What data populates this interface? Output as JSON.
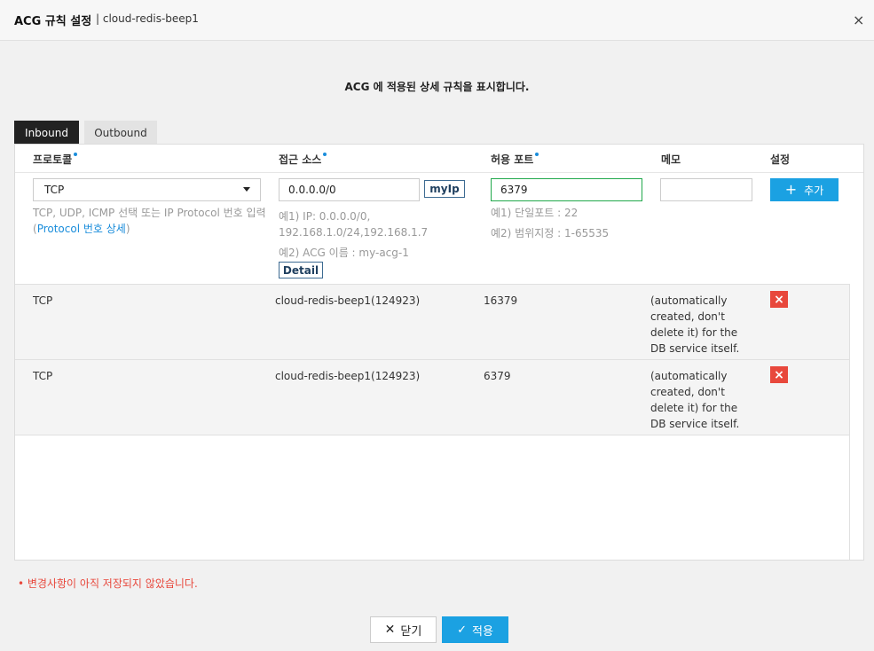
{
  "header": {
    "title": "ACG 규칙 설정",
    "subtitle": "| cloud-redis-beep1",
    "close_symbol": "×"
  },
  "description": "ACG 에 적용된 상세 규칙을 표시합니다.",
  "tabs": [
    {
      "label": "Inbound",
      "active": true
    },
    {
      "label": "Outbound",
      "active": false
    }
  ],
  "columns": {
    "protocol": "프로토콜",
    "source": "접근 소스",
    "port": "허용 포트",
    "memo": "메모",
    "settings": "설정"
  },
  "form": {
    "protocol_value": "TCP",
    "source_value": "0.0.0.0/0",
    "port_value": "6379",
    "memo_value": "",
    "myip_label": "myIp",
    "add_label": "추가",
    "detail_label": "Detail",
    "protocol_hint": "TCP, UDP, ICMP 선택 또는 IP Protocol 번호 입력",
    "protocol_hint_open": "(",
    "protocol_hint_link": "Protocol 번호 상세",
    "protocol_hint_close": ")",
    "source_hint1_line1": "예1) IP: 0.0.0.0/0,",
    "source_hint1_line2": "192.168.1.0/24,192.168.1.7",
    "source_hint2": "예2) ACG 이름 : my-acg-1",
    "port_hint1": "예1) 단일포트 : 22",
    "port_hint2": "예2) 범위지정 : 1-65535"
  },
  "rules": [
    {
      "protocol": "TCP",
      "source": "cloud-redis-beep1(124923)",
      "port": "16379",
      "memo": "(automatically created, don't delete it) for the DB service itself."
    },
    {
      "protocol": "TCP",
      "source": "cloud-redis-beep1(124923)",
      "port": "6379",
      "memo": "(automatically created, don't delete it) for the DB service itself."
    }
  ],
  "warning": "•  변경사항이 아직 저장되지 않았습니다.",
  "footer": {
    "close_label": "닫기",
    "apply_label": "적용"
  },
  "colors": {
    "accent": "#1ba1e2",
    "danger": "#e8483c",
    "valid": "#20a84b"
  }
}
